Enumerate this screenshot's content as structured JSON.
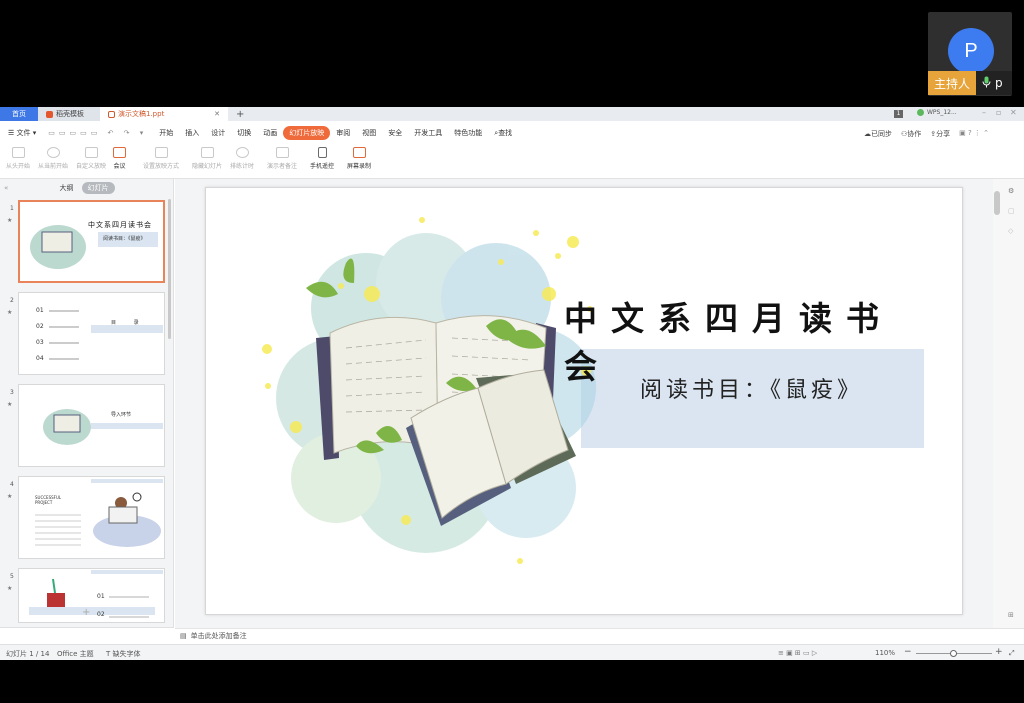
{
  "meeting": {
    "avatar_letter": "P",
    "host_label": "主持人",
    "user_initial": "p"
  },
  "tabs": {
    "home": "首页",
    "templates": "稻壳模板",
    "document": "演示文稿1.ppt",
    "new_tab": "+",
    "right_badge": "1",
    "right_account": "WPS_12..."
  },
  "menu": {
    "file": "文件",
    "items": [
      "开始",
      "插入",
      "设计",
      "切换",
      "动画",
      "幻灯片放映",
      "审阅",
      "视图",
      "安全",
      "开发工具",
      "特色功能"
    ],
    "active": "幻灯片放映",
    "search": "查找",
    "sync": "已同步",
    "collab": "协作",
    "share": "分享"
  },
  "ribbon": {
    "items": [
      "从头开始",
      "从当前开始",
      "自定义放映",
      "会议",
      "设置放映方式",
      "隐藏幻灯片",
      "排练计时",
      "演示者备注",
      "手机遥控",
      "屏幕录制"
    ]
  },
  "sidebar": {
    "outline_tab": "大纲",
    "slides_tab": "幻灯片",
    "add": "+"
  },
  "thumbs": {
    "t1_title": "中文系四月读书会",
    "t1_sub": "阅读书目：《鼠疫》",
    "t2_title": "目 录",
    "t2_nums": [
      "01",
      "02",
      "03",
      "04"
    ],
    "t3_title": "导入环节",
    "t4_title": "SUCCESSFUL PROJECT",
    "t5_nums": [
      "01",
      "02"
    ]
  },
  "slide": {
    "title": "中文系四月读书会",
    "subtitle": "阅读书目：《鼠疫》"
  },
  "notes": {
    "placeholder": "单击此处添加备注"
  },
  "status": {
    "slide_count": "幻灯片 1 / 14",
    "theme": "Office 主题",
    "missing_font": "缺失字体",
    "zoom": "110%"
  },
  "colors": {
    "accent": "#ef6b3b",
    "home_tab": "#3d78e6",
    "host_tag": "#e6a43a",
    "banner": "#dae5f1"
  }
}
